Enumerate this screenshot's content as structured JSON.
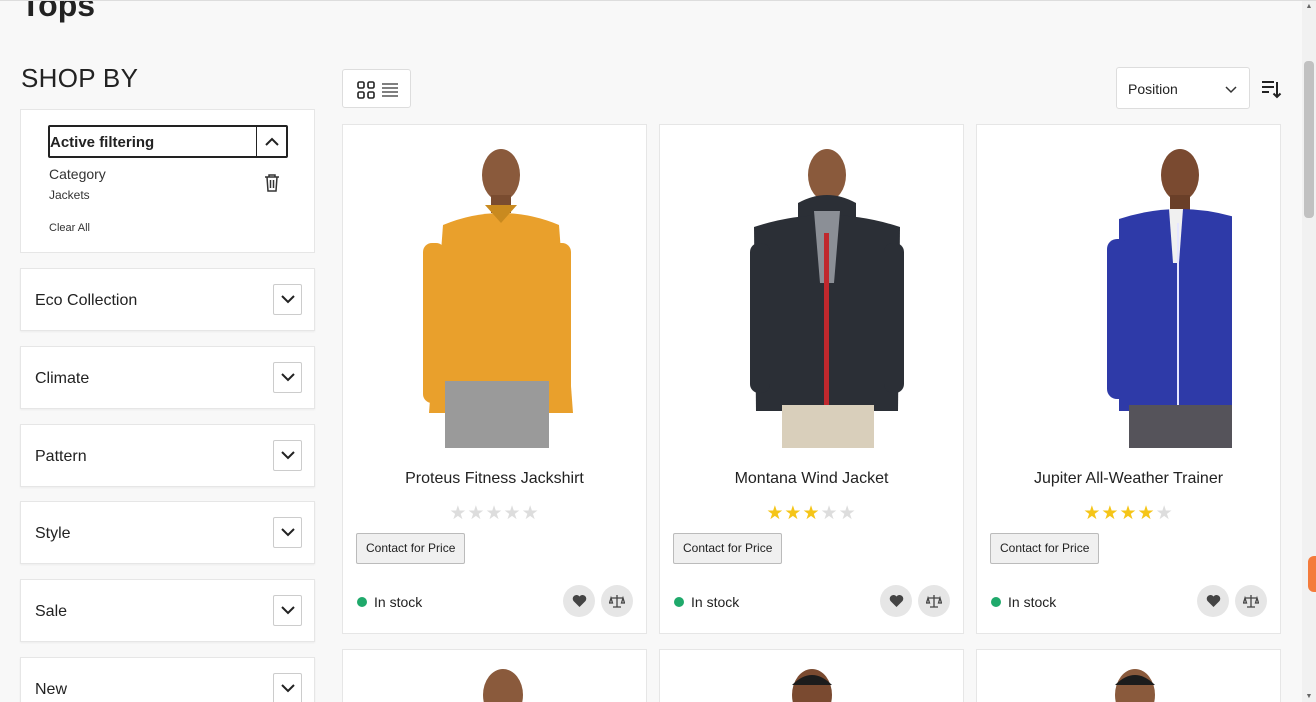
{
  "page": {
    "title": "Tops"
  },
  "sidebar": {
    "heading": "SHOP BY",
    "active_filtering": {
      "label": "Active filtering",
      "filter_name": "Category",
      "filter_value": "Jackets",
      "clear_all": "Clear All"
    },
    "facets": [
      {
        "label": "Eco Collection"
      },
      {
        "label": "Climate"
      },
      {
        "label": "Pattern"
      },
      {
        "label": "Style"
      },
      {
        "label": "Sale"
      },
      {
        "label": "New"
      }
    ]
  },
  "toolbar": {
    "view_modes": [
      "grid-icon",
      "list-icon"
    ],
    "sort_value": "Position",
    "sort_direction_icon": "sort-descending-icon"
  },
  "products": [
    {
      "name": "Proteus Fitness Jackshirt",
      "rating": 0,
      "price_label": "Contact for Price",
      "stock": "In stock",
      "shirt_color": "#e9a02c",
      "pants_color": "#9a9a9a"
    },
    {
      "name": "Montana Wind Jacket",
      "rating": 2.5,
      "price_label": "Contact for Price",
      "stock": "In stock",
      "shirt_color": "#2b2f36",
      "pants_color": "#d9cfbb"
    },
    {
      "name": "Jupiter All-Weather Trainer",
      "rating": 4,
      "price_label": "Contact for Price",
      "stock": "In stock",
      "shirt_color": "#2e3aa8",
      "pants_color": "#55535a"
    }
  ],
  "colors": {
    "in_stock": "#1fa96b",
    "star_on": "#f5c518",
    "star_off": "#dddddd",
    "accent_tab": "#f47b3b"
  }
}
